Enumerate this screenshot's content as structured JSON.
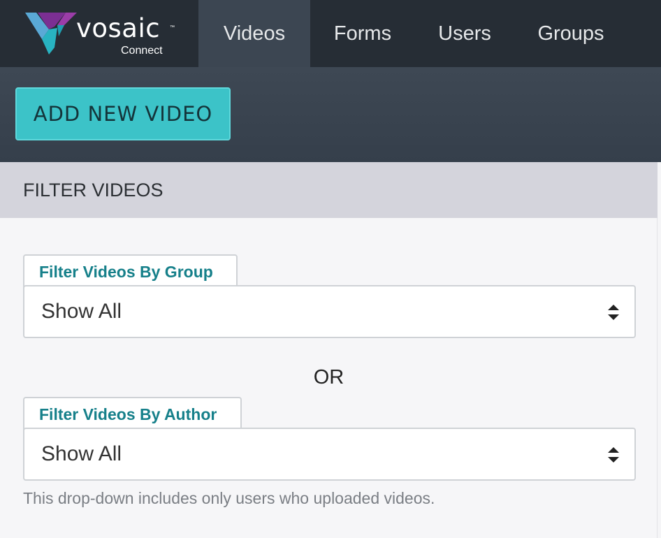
{
  "brand": {
    "name": "vosaic",
    "trademark": "™",
    "subtitle": "Connect"
  },
  "nav": {
    "tabs": [
      {
        "label": "Videos",
        "active": true
      },
      {
        "label": "Forms"
      },
      {
        "label": "Users"
      },
      {
        "label": "Groups"
      }
    ]
  },
  "toolbar": {
    "add_label": "ADD NEW VIDEO"
  },
  "filter": {
    "title": "FILTER VIDEOS",
    "group": {
      "label": "Filter Videos By Group",
      "value": "Show All"
    },
    "separator": "OR",
    "author": {
      "label": "Filter Videos By Author",
      "value": "Show All"
    },
    "help": "This drop-down includes only users who uploaded videos."
  },
  "colors": {
    "accent": "#3cc3c8",
    "label": "#16808a",
    "nav": "#262d35",
    "nav_active": "#3c4652"
  }
}
